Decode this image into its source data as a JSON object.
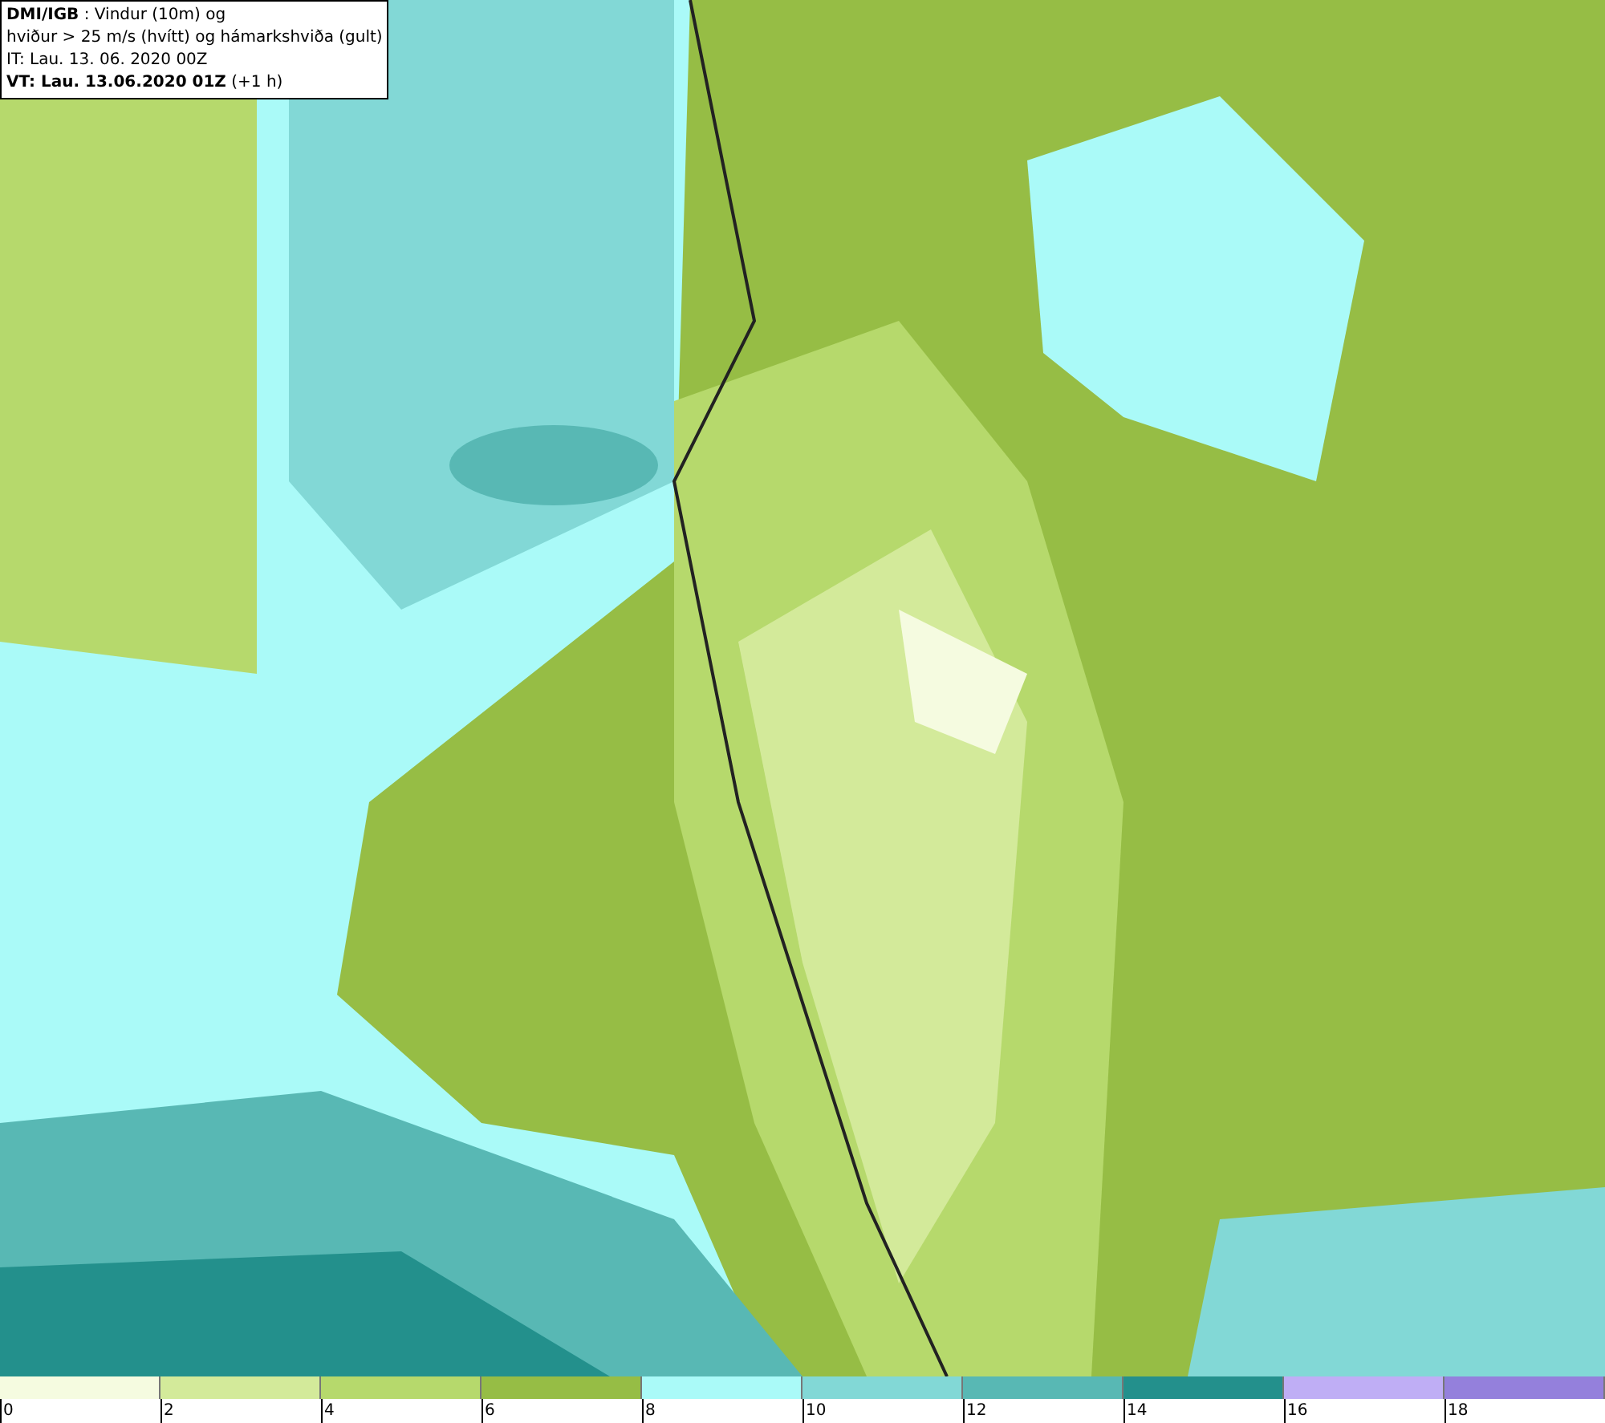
{
  "header": {
    "lines": [
      "**DMI/IGB** : Vindur (10m) og",
      "hviður > 25 m/s (hvítt) og hámarkshviða (gult)",
      "IT: Lau. 13. 06. 2020 00Z",
      "**VT: Lau. 13.06.2020 01Z** (+1 h)"
    ]
  },
  "legend": {
    "swatches": [
      {
        "label": "0",
        "color": "#f5fbe0"
      },
      {
        "label": "2",
        "color": "#d3ea9a"
      },
      {
        "label": "4",
        "color": "#b6d96c"
      },
      {
        "label": "6",
        "color": "#96bd45"
      },
      {
        "label": "8",
        "color": "#aafaf8"
      },
      {
        "label": "10",
        "color": "#82d8d6"
      },
      {
        "label": "12",
        "color": "#58b8b4"
      },
      {
        "label": "14",
        "color": "#23908c"
      },
      {
        "label": "16",
        "color": "#bfaef5"
      },
      {
        "label": "18",
        "color": "#9480dc"
      }
    ]
  }
}
